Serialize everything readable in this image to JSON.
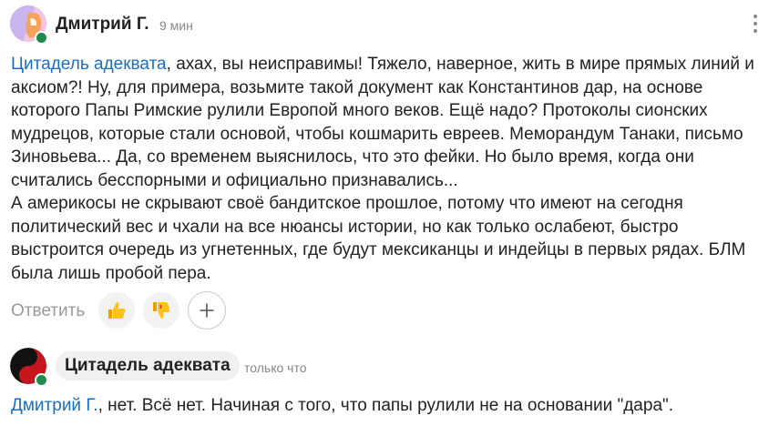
{
  "comment1": {
    "author": "Дмитрий Г.",
    "time": "9 мин",
    "mention": "Цитадель адеквата",
    "text": ", ахах, вы неисправимы! Тяжело, наверное, жить в мире прямых линий и аксиом?! Ну, для примера, возьмите такой документ как Константинов дар, на основе которого Папы Римские рулили Европой много веков. Ещё надо? Протоколы сионских мудрецов, которые стали основой, чтобы кошмарить евреев. Меморандум Танаки, письмо Зиновьева... Да, со временем выяснилось, что это фейки. Но было время, когда они считались бесспорными и официально признавались...",
    "text2": "А америкосы не скрывают своё бандитское прошлое, потому что имеют на сегодня политический вес и чхали на все нюансы истории, но как только ослабеют, быстро выстроится очередь из угнетенных, где будут мексиканцы и индейцы в первых рядах. БЛМ была лишь пробой пера."
  },
  "actions": {
    "reply_label": "Ответить",
    "like_icon": "thumbs-up-icon",
    "dislike_icon": "thumbs-down-icon",
    "add_reaction_icon": "plus-icon"
  },
  "comment2": {
    "author": "Цитадель адеквата",
    "time": "только что",
    "mention": "Дмитрий Г.",
    "text": ", нет. Всё нет. Начиная с того, что папы рулили не на основании \"дара\"."
  },
  "colors": {
    "link": "#1a6fc1",
    "online": "#1f8a4c",
    "muted": "#888888"
  }
}
